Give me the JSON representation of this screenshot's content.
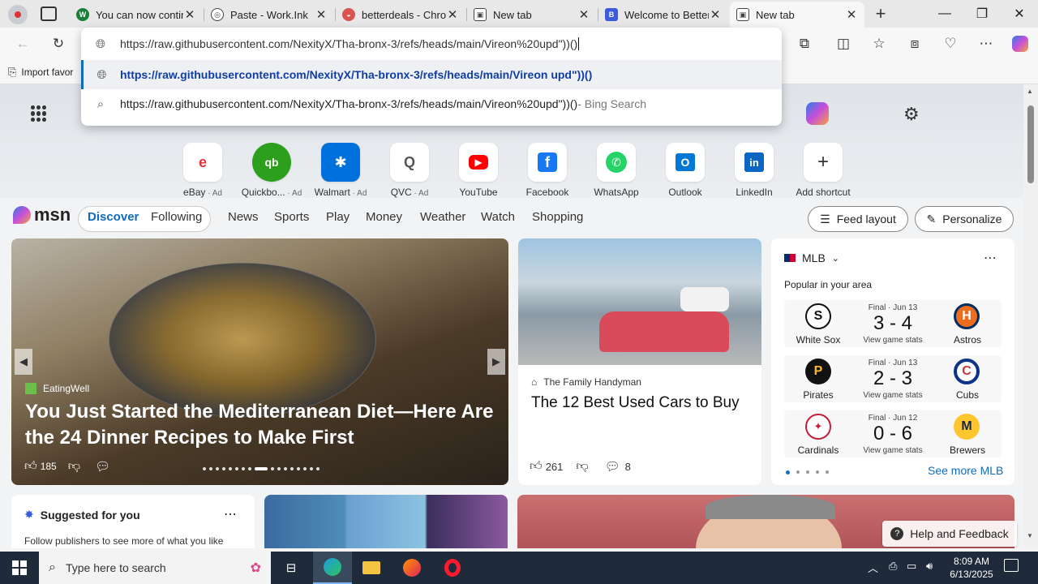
{
  "tabs": [
    {
      "title": "You can now contin",
      "color": "#1a7f37",
      "glyph": "W"
    },
    {
      "title": "Paste - Work.Ink",
      "color": "#555555",
      "glyph": "◎"
    },
    {
      "title": "betterdeals - Chron",
      "color": "#d9534f",
      "glyph": "◒"
    },
    {
      "title": "New tab",
      "color": "#444444",
      "glyph": "▣"
    },
    {
      "title": "Welcome to Better",
      "color": "#3b5bdb",
      "glyph": "B"
    },
    {
      "title": "New tab",
      "color": "#444444",
      "glyph": "▣"
    }
  ],
  "omnibox": {
    "input_value": "https://raw.githubusercontent.com/NexityX/Tha-bronx-3/refs/heads/main/Vireon%20upd\"))()",
    "suggestion_1": "https://raw.githubusercontent.com/NexityX/Tha-bronx-3/refs/heads/main/Vireon upd\"))()",
    "suggestion_2": "https://raw.githubusercontent.com/NexityX/Tha-bronx-3/refs/heads/main/Vireon%20upd\"))()",
    "suggestion_2_suffix": " - Bing Search"
  },
  "favbar": {
    "import_label": "Import favor"
  },
  "shortcuts": [
    {
      "label": "eBay",
      "ad": " · Ad",
      "glyph": "e",
      "color": "#e53238"
    },
    {
      "label": "Quickbo...",
      "ad": " · Ad",
      "glyph": "qb",
      "color": "#2ca01c"
    },
    {
      "label": "Walmart",
      "ad": " · Ad",
      "glyph": "✱",
      "color": "#0071dc"
    },
    {
      "label": "QVC",
      "ad": " · Ad",
      "glyph": "Q",
      "color": "#555555"
    },
    {
      "label": "YouTube",
      "ad": "",
      "glyph": "▶",
      "color": "#ff0000"
    },
    {
      "label": "Facebook",
      "ad": "",
      "glyph": "f",
      "color": "#1877f2"
    },
    {
      "label": "WhatsApp",
      "ad": "",
      "glyph": "✆",
      "color": "#25d366"
    },
    {
      "label": "Outlook",
      "ad": "",
      "glyph": "O",
      "color": "#0078d4"
    },
    {
      "label": "LinkedIn",
      "ad": "",
      "glyph": "in",
      "color": "#0a66c2"
    },
    {
      "label": "Add shortcut",
      "ad": "",
      "glyph": "+",
      "color": "#333333"
    }
  ],
  "msn": {
    "logo": "msn",
    "discover": "Discover",
    "following": "Following",
    "nav": [
      "News",
      "Sports",
      "Play",
      "Money",
      "Weather",
      "Watch",
      "Shopping"
    ],
    "feed_layout": "Feed layout",
    "personalize": "Personalize"
  },
  "hero_card": {
    "source": "EatingWell",
    "headline": "You Just Started the Mediterranean Diet—Here Are the 24 Dinner Recipes to Make First",
    "likes": "185"
  },
  "cars_card": {
    "source": "The Family Handyman",
    "headline": "The 12 Best Used Cars to Buy",
    "likes": "261",
    "comments": "8"
  },
  "mlb": {
    "title": "MLB",
    "subtitle": "Popular in your area",
    "games": [
      {
        "away": "White Sox",
        "home": "Astros",
        "status": "Final · Jun 13",
        "score": "3 - 4",
        "stats": "View game stats",
        "away_color": "#111111",
        "home_color": "#002d62",
        "away_glyph": "S",
        "home_glyph": "H"
      },
      {
        "away": "Pirates",
        "home": "Cubs",
        "status": "Final · Jun 13",
        "score": "2 - 3",
        "stats": "View game stats",
        "away_color": "#fdb827",
        "home_color": "#0e3386",
        "away_glyph": "P",
        "home_glyph": "C"
      },
      {
        "away": "Cardinals",
        "home": "Brewers",
        "status": "Final · Jun 12",
        "score": "0 - 6",
        "stats": "View game stats",
        "away_color": "#c41e3a",
        "home_color": "#12284b",
        "away_glyph": "✦",
        "home_glyph": "M"
      }
    ],
    "see_more": "See more MLB"
  },
  "suggested": {
    "title": "Suggested for you",
    "body": "Follow publishers to see more of what you like"
  },
  "help": "Help and Feedback",
  "taskbar": {
    "search_placeholder": "Type here to search",
    "time": "8:09 AM",
    "date": "6/13/2025"
  }
}
